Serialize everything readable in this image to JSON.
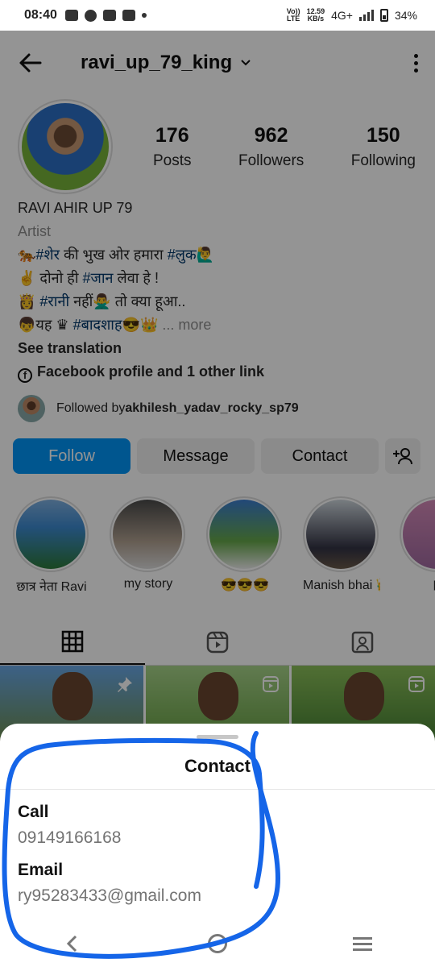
{
  "status_bar": {
    "time": "08:40",
    "network_top": "Vo))",
    "network_bottom": "LTE",
    "speed_top": "12.59",
    "speed_bottom": "KB/s",
    "signal": "4G+",
    "battery": "34%"
  },
  "header": {
    "username": "ravi_up_79_king"
  },
  "stats": [
    {
      "num": "176",
      "label": "Posts"
    },
    {
      "num": "962",
      "label": "Followers"
    },
    {
      "num": "150",
      "label": "Following"
    }
  ],
  "bio": {
    "name": "RAVI AHIR UP 79",
    "category": "Artist",
    "line1_emoji": "🐅",
    "line1_tag1": "#शेर",
    "line1_text": " की भुख ओर हमारा ",
    "line1_tag2": "#लुक",
    "line1_end": "🙋‍♂️",
    "line2_start": "✌️ दोनो ही ",
    "line2_tag": "#जान",
    "line2_end": " लेवा हे !",
    "line3_start": "👸 ",
    "line3_tag": "#रानी",
    "line3_end": " नहीं🙅‍♂️ तो क्या हूआ..",
    "line4_start": "👦यह ♛ ",
    "line4_tag": "#बादशाह",
    "line4_end": "😎👑 ",
    "line4_more": "... more",
    "see_translation": "See translation",
    "links": "Facebook profile and 1 other link"
  },
  "followed_by": {
    "prefix": "Followed by ",
    "user": "akhilesh_yadav_rocky_sp79"
  },
  "actions": {
    "follow": "Follow",
    "message": "Message",
    "contact": "Contact"
  },
  "highlights": [
    {
      "label": "छात्र नेता Ravi"
    },
    {
      "label": "my story"
    },
    {
      "label": "😎😎😎"
    },
    {
      "label": "Manish bhai 👑"
    },
    {
      "label": "pl"
    }
  ],
  "sheet": {
    "title": "Contact",
    "call_label": "Call",
    "call_value": "09149166168",
    "email_label": "Email",
    "email_value": "ry95283433@gmail.com"
  },
  "colors": {
    "primary": "#0095f6",
    "hashtag": "#00376b",
    "scribble": "#1565e8"
  }
}
